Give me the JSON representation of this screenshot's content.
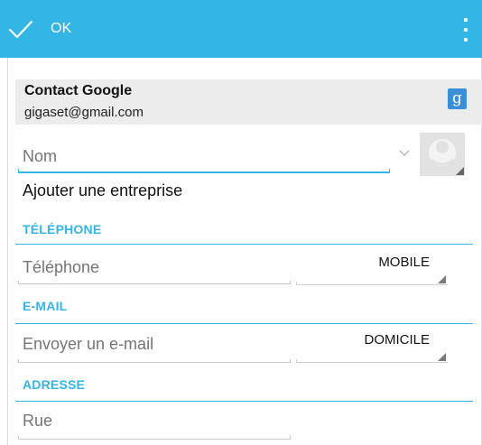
{
  "actionbar": {
    "done_icon": "checkmark-icon",
    "done_label": "OK",
    "overflow_icon": "overflow-menu-icon",
    "background": "#33b5e5"
  },
  "account": {
    "name": "Contact Google",
    "email": "gigaset@gmail.com",
    "badge_icon": "google-account-icon",
    "badge_glyph": "g"
  },
  "name_field": {
    "value": "Nom",
    "expand_icon": "chevron-down-icon",
    "photo_icon": "contact-photo-icon"
  },
  "add_organization": "Ajouter une entreprise",
  "sections": {
    "phone": {
      "title": "TÉLÉPHONE",
      "placeholder": "Téléphone",
      "type": "MOBILE"
    },
    "email": {
      "title": "E-MAIL",
      "placeholder": "Envoyer un e-mail",
      "type": "DOMICILE"
    },
    "address": {
      "title": "ADRESSE",
      "placeholder": "Rue"
    }
  },
  "colors": {
    "accent": "#33b5e5",
    "header_background": "#ececec"
  }
}
